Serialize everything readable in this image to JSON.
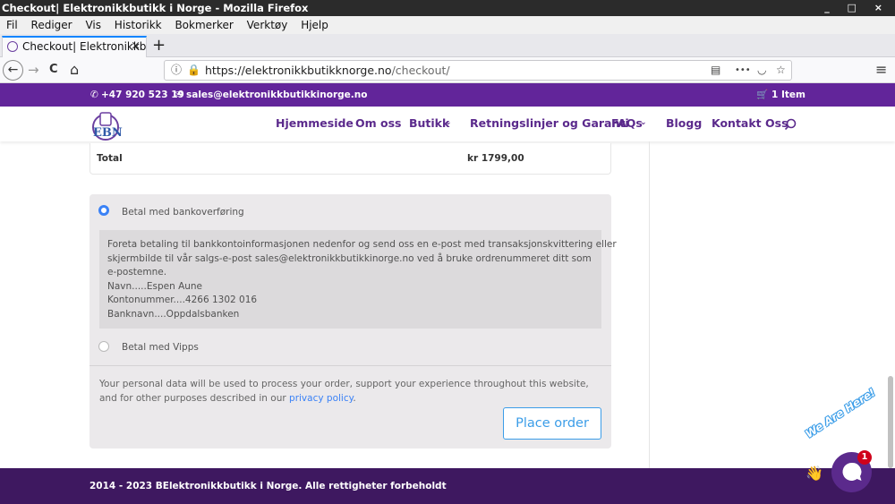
{
  "window": {
    "title": "Checkout| Elektronikkbutikk i Norge - Mozilla Firefox",
    "controls": "_ □ ×"
  },
  "menu": [
    "Fil",
    "Rediger",
    "Vis",
    "Historikk",
    "Bokmerker",
    "Verktøy",
    "Hjelp"
  ],
  "tab": {
    "label": "Checkout| Elektronikkbutikk i Norge",
    "close": "×",
    "new": "+"
  },
  "nav": {
    "back": "←",
    "forward": "→",
    "reload": "C",
    "home": "⌂",
    "url_host": "https://elektronikkbutikknorge.no",
    "url_path": "/checkout/",
    "more": "•••",
    "menu_icon": "≡"
  },
  "topbar": {
    "phone": "+47 920 523 19",
    "email": "sales@elektronikkbutikkinorge.no",
    "cart": "1 Item"
  },
  "header": {
    "logo_text": "EBN",
    "links": [
      "Hjemmeside",
      "Om oss",
      "Butikk",
      "Retningslinjer og Garanti",
      "FAQs",
      "Blogg",
      "Kontakt Oss"
    ]
  },
  "summary": {
    "total_label": "Total",
    "total_value": "kr 1799,00"
  },
  "payment": {
    "bank_label": "Betal med bankoverføring",
    "bank_desc_lines": [
      "Foreta betaling til bankkontoinformasjonen nedenfor og send oss en e-post med transaksjonskvittering eller",
      "skjermbilde til vår salgs-e-post sales@elektronikkbutikkinorge.no ved å bruke ordrenummeret ditt som",
      "e-postemne.",
      "Navn.....Espen Aune",
      "Kontonummer....4266 1302 016",
      "Banknavn....Oppdalsbanken"
    ],
    "vipps_label": "Betal med Vipps",
    "privacy_text": "Your personal data will be used to process your order, support your experience throughout this website, and for other purposes described in our",
    "privacy_link": "privacy policy",
    "privacy_end": ".",
    "place_order": "Place order"
  },
  "footer": {
    "copyright": "2014 - 2023 BElektronikkbutikk i Norge. Alle rettigheter forbeholdt"
  },
  "chat": {
    "label": "We Are Here!",
    "badge": "1"
  },
  "colors": {
    "brand_purple": "#62259a",
    "footer_purple": "#3e1860",
    "accent_blue": "#3b9de8"
  }
}
